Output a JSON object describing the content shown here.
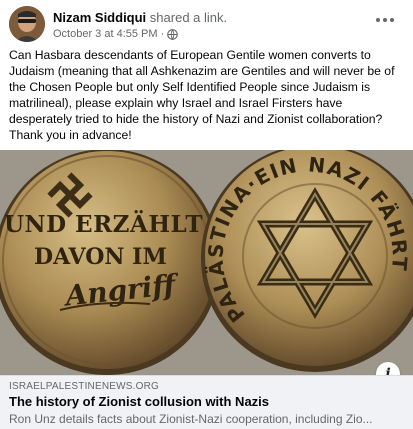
{
  "post": {
    "author": "Nizam Siddiqui",
    "action": "shared a link.",
    "timestamp": "October 3 at 4:55 PM",
    "separator": "·",
    "privacy_icon": "globe-icon",
    "more_icon": "more-horizontal-icon",
    "text": "Can Hasbara descendants of European Gentile women converts to Judaism (meaning that all Ashkenazim are Gentiles and will never be of the Chosen People but only Self Identified People since Judaism is matrilineal), please explain why Israel and Israel Firsters have desperately tried to hide the history of Nazi and Zionist collaboration? Thank you in advance!"
  },
  "image": {
    "left_coin": {
      "symbol": "swastika",
      "line1": "UND ERZÄHLT",
      "line2": "DAVON IM",
      "line3": "Angriff"
    },
    "right_coin": {
      "symbol": "star-of-david",
      "rim_text": "PALÄSTINA·EIN NAZI FÄHRT NACH"
    },
    "info_icon": "info-icon",
    "info_label": "i"
  },
  "link": {
    "domain": "ISRAELPALESTINENEWS.ORG",
    "title": "The history of Zionist collusion with Nazis",
    "description": "Ron Unz details facts about Zionist-Nazi cooperation, including Zio..."
  },
  "colors": {
    "author": "#050505",
    "secondary": "#65676b",
    "preview_bg": "#f0f2f5",
    "coin_bronze": "#b8995d",
    "coin_dark": "#5a4526"
  }
}
